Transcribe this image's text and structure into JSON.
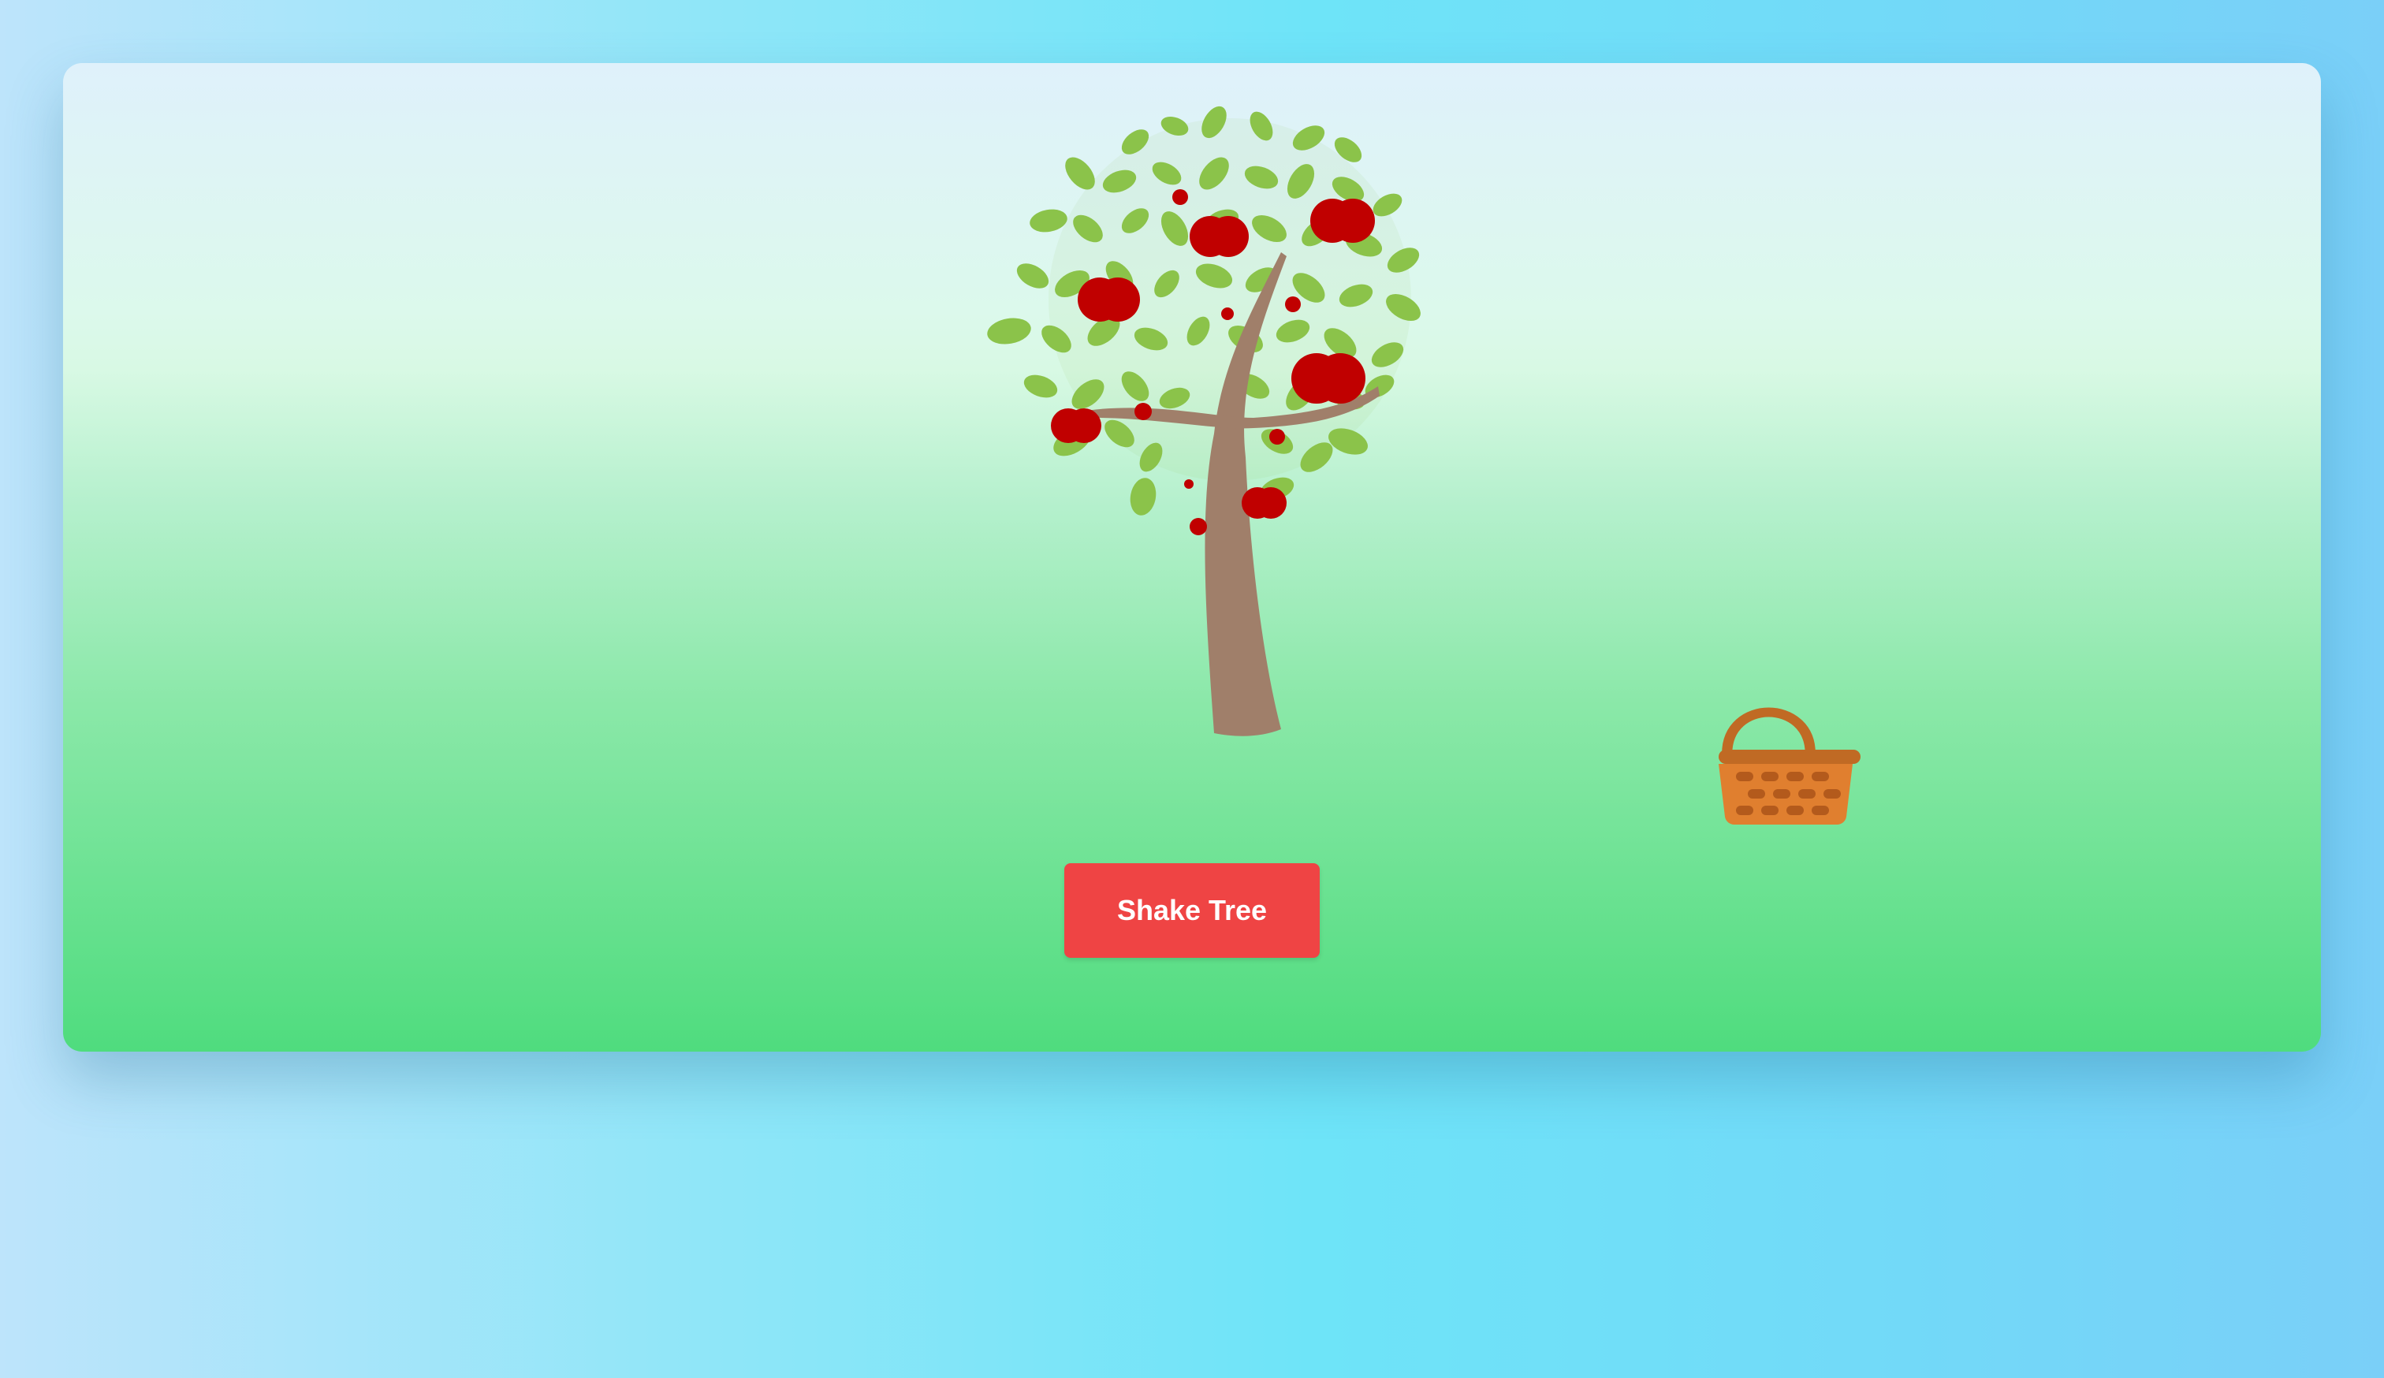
{
  "game": {
    "controls": {
      "shake_label": "Shake Tree"
    },
    "sprites": {
      "tree": "apple-tree",
      "basket": "basket-icon"
    },
    "colors": {
      "sky_top": "#dff1fb",
      "grass_bottom": "#4fdc7e",
      "button": "#ef4444",
      "leaf": "#8bc34a",
      "apple": "#c00000",
      "trunk": "#a07f6a",
      "basket": "#d9792b"
    }
  }
}
